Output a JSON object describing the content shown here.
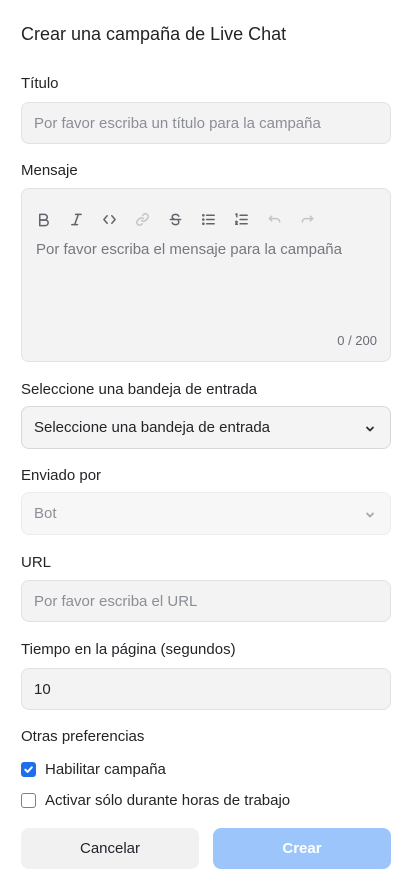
{
  "form": {
    "title": "Crear una campaña de Live Chat",
    "title_field": {
      "label": "Título",
      "value": "",
      "placeholder": "Por favor escriba un título para la campaña"
    },
    "message_field": {
      "label": "Mensaje",
      "value": "",
      "placeholder": "Por favor escriba el mensaje para la campaña",
      "counter": "0 / 200",
      "toolbar": [
        {
          "icon": "bold-icon",
          "enabled": true
        },
        {
          "icon": "italic-icon",
          "enabled": true
        },
        {
          "icon": "code-icon",
          "enabled": true
        },
        {
          "icon": "link-icon",
          "enabled": false
        },
        {
          "icon": "strikethrough-icon",
          "enabled": true
        },
        {
          "icon": "bullet-list-icon",
          "enabled": true
        },
        {
          "icon": "numbered-list-icon",
          "enabled": true
        },
        {
          "icon": "undo-icon",
          "enabled": false
        },
        {
          "icon": "redo-icon",
          "enabled": false
        }
      ]
    },
    "inbox_field": {
      "label": "Seleccione una bandeja de entrada",
      "selected": "Seleccione una bandeja de entrada"
    },
    "sender_field": {
      "label": "Enviado por",
      "selected": "Bot",
      "disabled": true
    },
    "url_field": {
      "label": "URL",
      "value": "",
      "placeholder": "Por favor escriba el URL"
    },
    "time_field": {
      "label": "Tiempo en la página (segundos)",
      "value": "10"
    },
    "preferences": {
      "label": "Otras preferencias",
      "enable_campaign": {
        "label": "Habilitar campaña",
        "checked": true
      },
      "business_hours": {
        "label": "Activar sólo durante horas de trabajo",
        "checked": false
      }
    },
    "actions": {
      "cancel_label": "Cancelar",
      "create_label": "Crear"
    }
  },
  "colors": {
    "accent": "#1f6feb",
    "create_button_disabled": "#9cc6fb",
    "field_background": "#f3f3f4"
  }
}
